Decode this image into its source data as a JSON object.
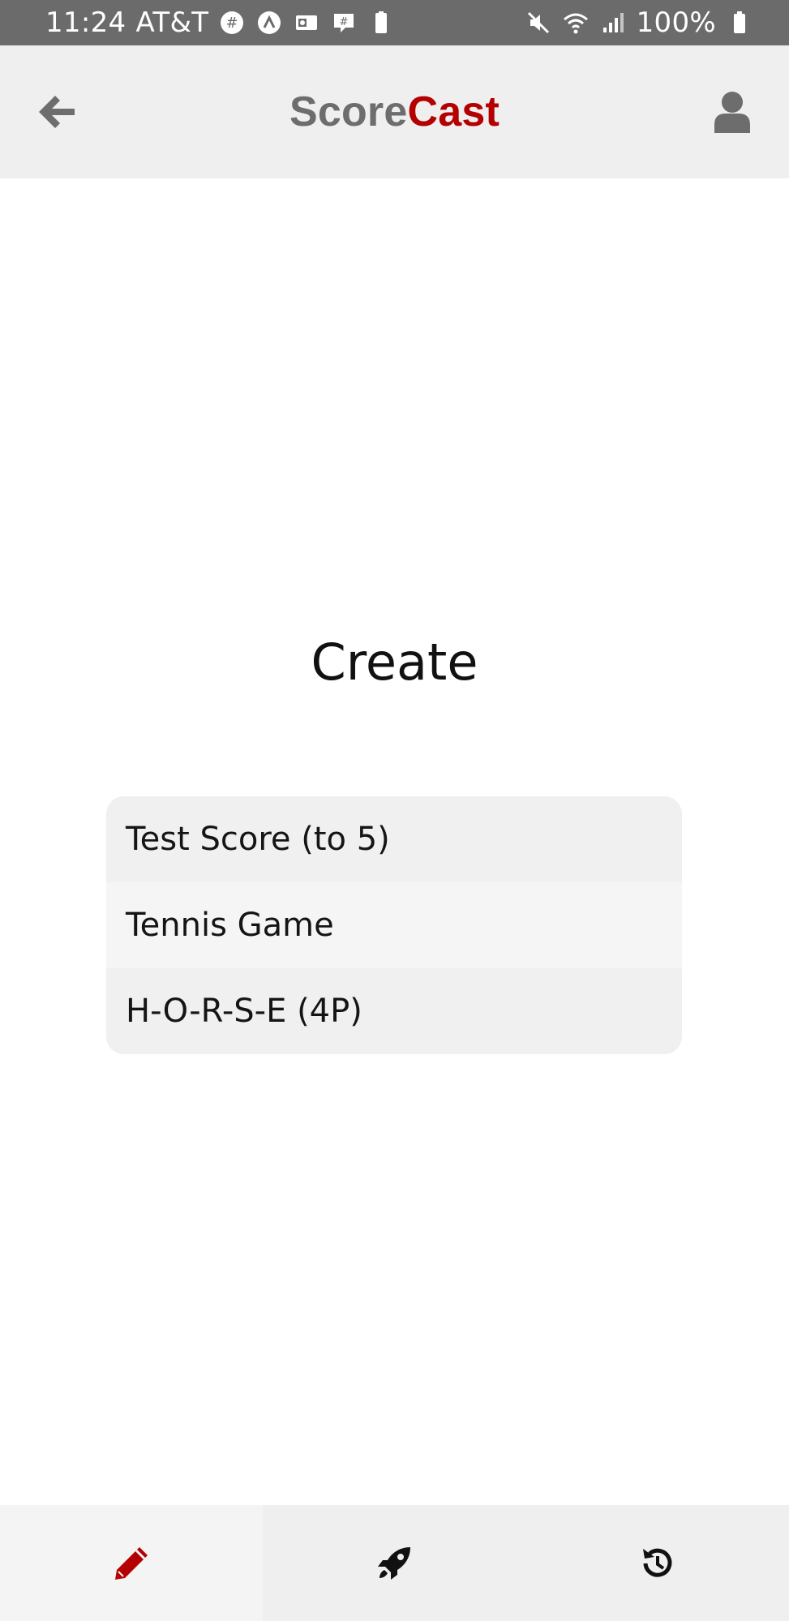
{
  "status_bar": {
    "time": "11:24",
    "carrier": "AT&T",
    "battery": "100%",
    "left_icons": [
      "slack-icon",
      "arc-icon",
      "outlook-icon",
      "chat-icon",
      "battery-saver-icon"
    ],
    "right_icons": [
      "mute-icon",
      "wifi-icon",
      "signal-icon",
      "battery-icon"
    ]
  },
  "header": {
    "brand_part1": "Score",
    "brand_part2": "Cast",
    "back_icon": "arrow-left-icon",
    "user_icon": "user-icon"
  },
  "main": {
    "title": "Create",
    "games": [
      {
        "label": "Test Score (to 5)"
      },
      {
        "label": "Tennis Game"
      },
      {
        "label": "H-O-R-S-E (4P)"
      }
    ]
  },
  "bottom_nav": {
    "tabs": [
      {
        "icon": "pencil-icon",
        "active": true
      },
      {
        "icon": "rocket-icon",
        "active": false
      },
      {
        "icon": "history-icon",
        "active": false
      }
    ]
  },
  "colors": {
    "accent": "#b40000",
    "brand_gray": "#6d6d6d",
    "header_bg": "#efefef",
    "status_bg": "#6b6b6b"
  }
}
